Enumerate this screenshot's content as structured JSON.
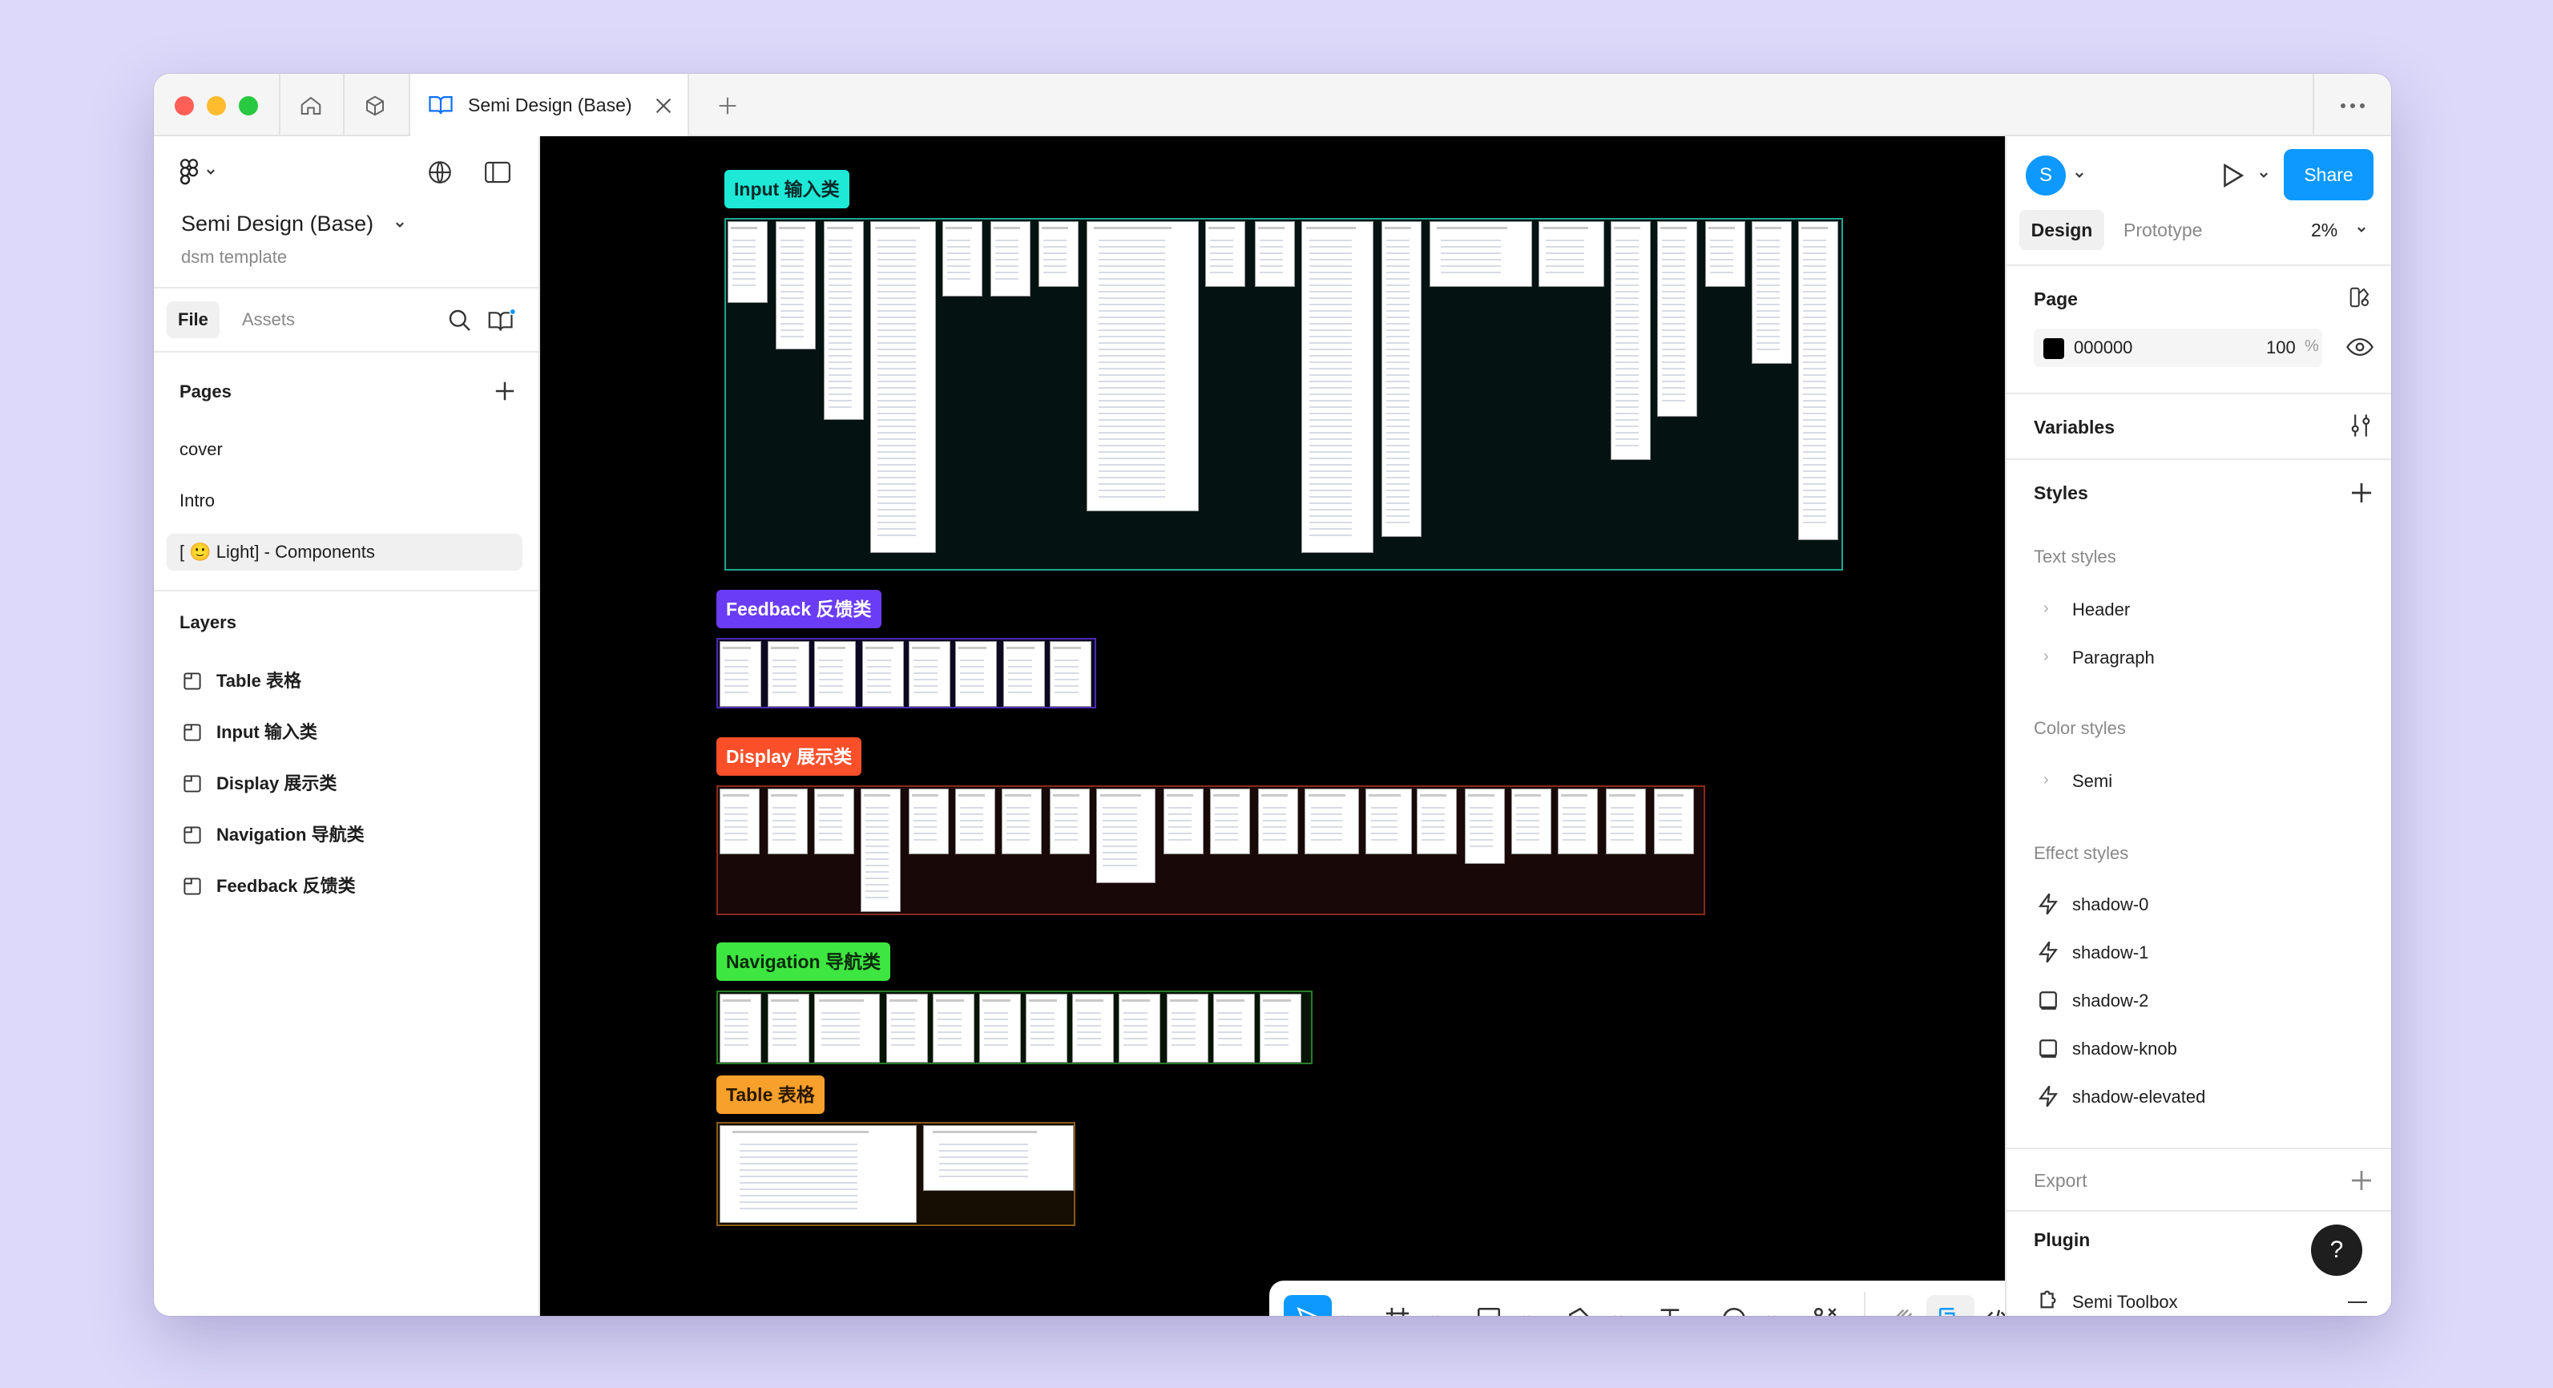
{
  "titlebar": {
    "tab_title": "Semi Design (Base)",
    "traffic_colors": [
      "#ff5f57",
      "#febc2e",
      "#28c840"
    ]
  },
  "left": {
    "project_title": "Semi Design (Base)",
    "project_subtitle": "dsm template",
    "tabs": {
      "file": "File",
      "assets": "Assets"
    },
    "pages_title": "Pages",
    "pages": [
      "cover",
      "Intro",
      "[ 🙂 Light] - Components"
    ],
    "layers_title": "Layers",
    "layers": [
      "Table 表格",
      "Input 输入类",
      "Display 展示类",
      "Navigation 导航类",
      "Feedback 反馈类"
    ]
  },
  "canvas": {
    "background": "#000000",
    "sections": [
      {
        "label": "Input 输入类",
        "color": "#1de9d6"
      },
      {
        "label": "Feedback 反馈类",
        "color": "#6b3cf5"
      },
      {
        "label": "Display 展示类",
        "color": "#fb4f2a"
      },
      {
        "label": "Navigation 导航类",
        "color": "#3ee641"
      },
      {
        "label": "Table 表格",
        "color": "#f7a02b"
      }
    ]
  },
  "toolbar": {
    "tools": [
      "move-tool",
      "frame-tool",
      "shape-tool",
      "pen-tool",
      "text-tool",
      "comment-tool",
      "actions-tool",
      "draw-mode",
      "design-mode",
      "dev-mode"
    ]
  },
  "right": {
    "avatar_letter": "S",
    "share_label": "Share",
    "accent": "#0d99ff",
    "tabs": {
      "design": "Design",
      "prototype": "Prototype"
    },
    "zoom": "2%",
    "page_title": "Page",
    "page_fill_hex": "000000",
    "page_fill_opacity": "100",
    "percent_sign": "%",
    "variables_title": "Variables",
    "styles_title": "Styles",
    "text_styles_title": "Text styles",
    "text_styles": [
      "Header",
      "Paragraph"
    ],
    "color_styles_title": "Color styles",
    "color_styles": [
      "Semi"
    ],
    "effect_styles_title": "Effect styles",
    "effect_styles": [
      "shadow-0",
      "shadow-1",
      "shadow-2",
      "shadow-knob",
      "shadow-elevated"
    ],
    "export_title": "Export",
    "plugin_title": "Plugin",
    "plugin_item": "Semi Toolbox",
    "help_label": "?"
  }
}
